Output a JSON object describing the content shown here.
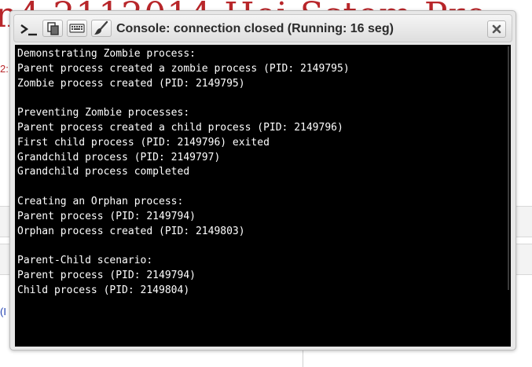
{
  "background": {
    "heading_fragment": "n4 2112014 Hei Sstem Pro",
    "red_fragment": "2:",
    "blue_fragment": "(I"
  },
  "dialog": {
    "title": "Console: connection closed (Running: 16 seg)",
    "toolbar_icons": [
      "terminal-prompt-icon",
      "copy-icon",
      "keyboard-icon",
      "brush-icon",
      "close-icon"
    ],
    "console_lines": [
      "Demonstrating Zombie process:",
      "Parent process created a zombie process (PID: 2149795)",
      "Zombie process created (PID: 2149795)",
      "",
      "Preventing Zombie processes:",
      "Parent process created a child process (PID: 2149796)",
      "First child process (PID: 2149796) exited",
      "Grandchild process (PID: 2149797)",
      "Grandchild process completed",
      "",
      "Creating an Orphan process:",
      "Parent process (PID: 2149794)",
      "Orphan process created (PID: 2149803)",
      "",
      "Parent-Child scenario:",
      "Parent process (PID: 2149794)",
      "Child process (PID: 2149804)"
    ]
  },
  "colors": {
    "console_background": "#000000",
    "console_text": "#ffffff",
    "background_heading": "#b8262a"
  }
}
